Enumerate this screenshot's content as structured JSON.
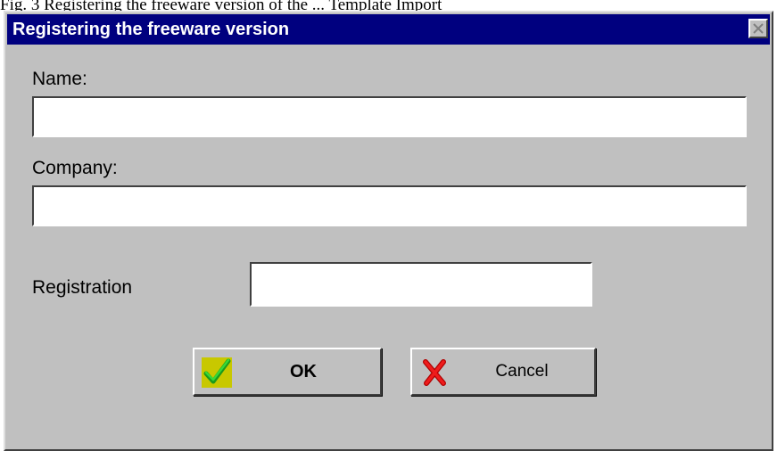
{
  "page_caption": "Fig. 3 Registering the freeware version of the ... Template Import",
  "dialog": {
    "title": "Registering the freeware version",
    "close_icon": "close-icon"
  },
  "form": {
    "name_label": "Name:",
    "name_value": "",
    "company_label": "Company:",
    "company_value": "",
    "registration_label": "Registration",
    "registration_value": ""
  },
  "buttons": {
    "ok_label": "OK",
    "ok_icon": "checkmark-icon",
    "cancel_label": "Cancel",
    "cancel_icon": "x-cross-icon"
  },
  "colors": {
    "title_bar": "#00007f",
    "dialog_face": "#c0c0c0",
    "ok_check": "#22c022",
    "cancel_cross": "#e00000"
  }
}
